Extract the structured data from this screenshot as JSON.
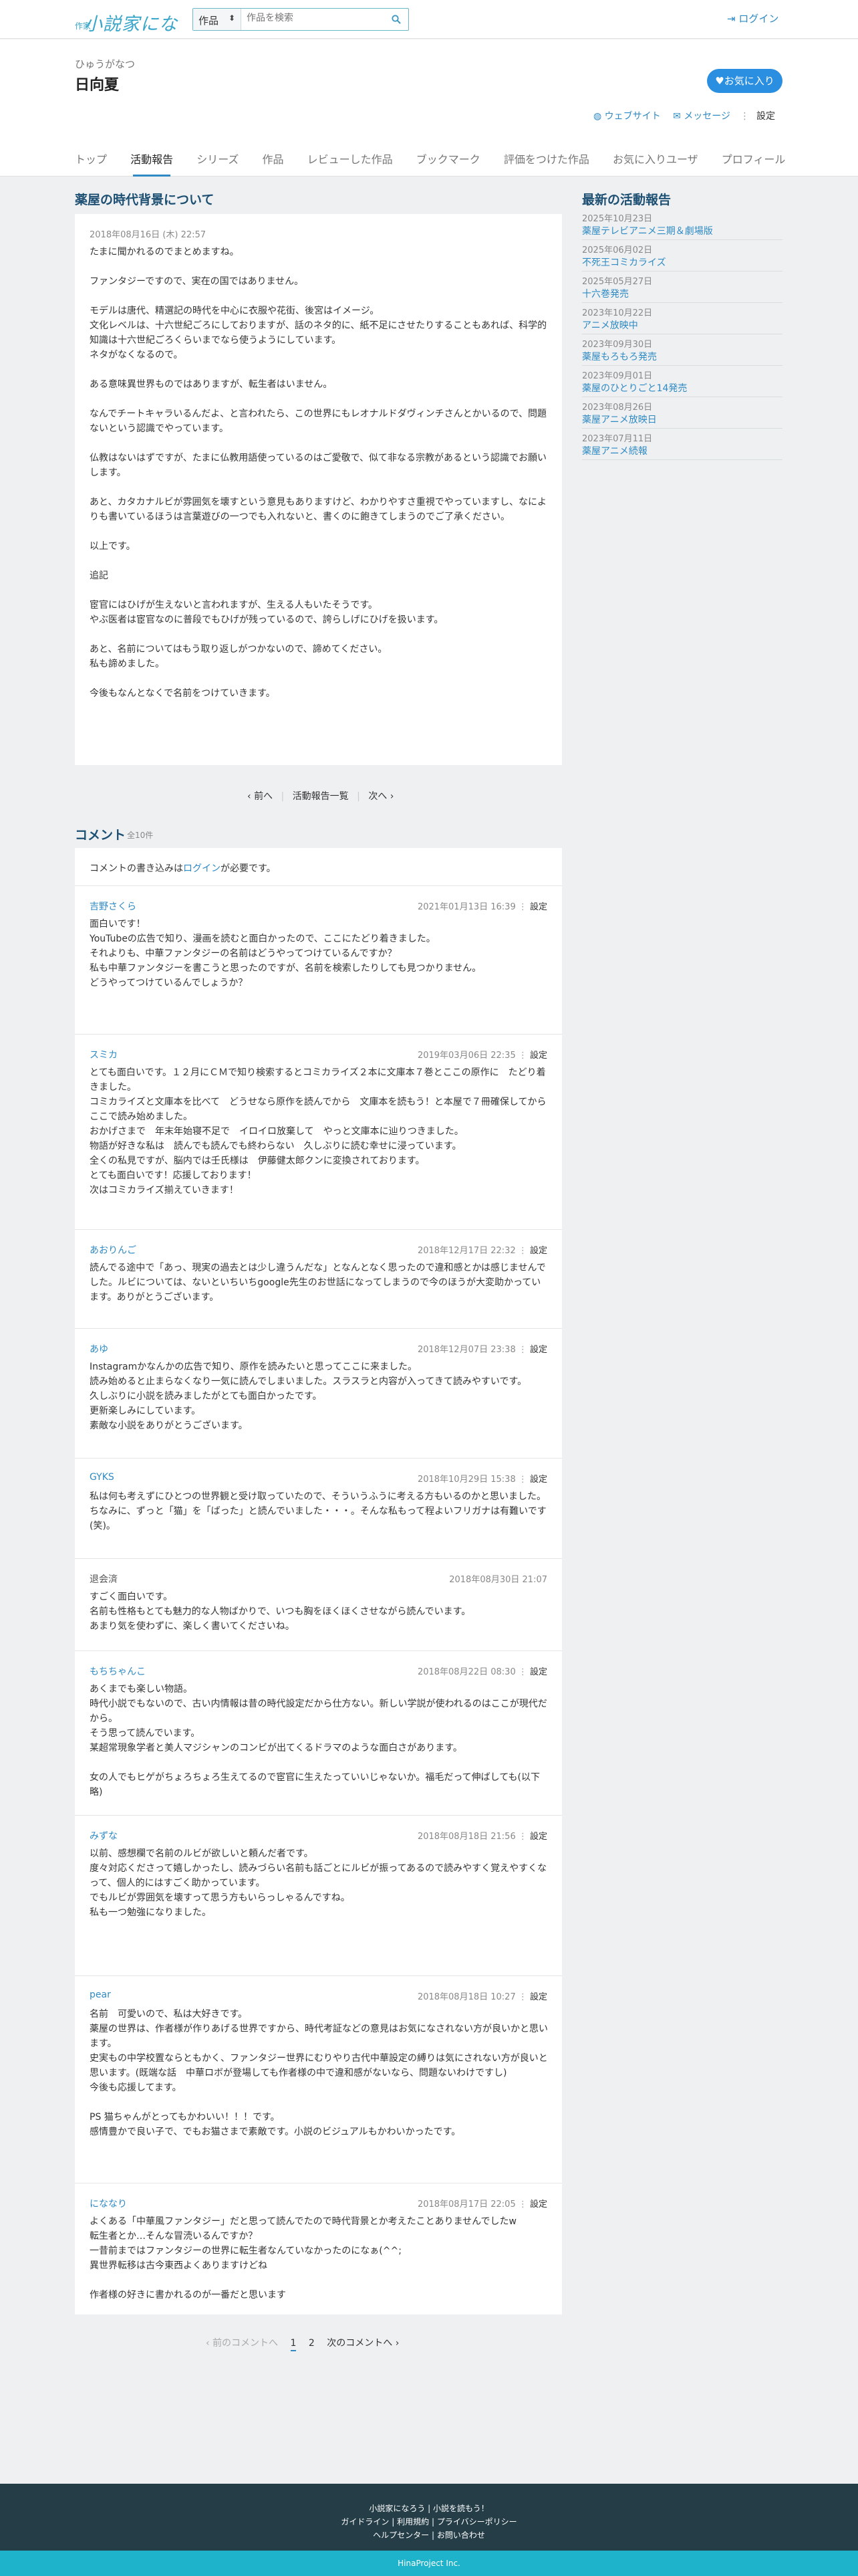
{
  "header": {
    "logo_small": "作家",
    "logo_main": "小説家になろう",
    "search_category": "作品",
    "search_placeholder": "作品を検索",
    "login": "ログイン"
  },
  "profile": {
    "kana": "ひゅうがなつ",
    "name": "日向夏",
    "favorite": "お気に入り",
    "website": "ウェブサイト",
    "message": "メッセージ",
    "settings": "設定",
    "tabs": [
      "トップ",
      "活動報告",
      "シリーズ",
      "作品",
      "レビューした作品",
      "ブックマーク",
      "評価をつけた作品",
      "お気に入りユーザ",
      "プロフィール"
    ]
  },
  "report": {
    "title": "薬屋の時代背景について",
    "date": "2018年08月16日 (木) 22:57",
    "body": "たまに聞かれるのでまとめますね。\n\nファンタジーですので、実在の国ではありません。\n\nモデルは唐代、精選記の時代を中心に衣服や花街、後宮はイメージ。\n文化レベルは、十六世紀ごろにしておりますが、話のネタ的に、紙不足にさせたりすることもあれば、科学的知識は十六世紀ごろくらいまでなら使うようにしています。\nネタがなくなるので。\n\nある意味異世界ものではありますが、転生者はいません。\n\nなんでチートキャラいるんだよ、と言われたら、この世界にもレオナルドダヴィンチさんとかいるので、問題ないという認識でやっています。\n\n仏教はないはずですが、たまに仏教用語使っているのはご愛敬で、似て非なる宗教があるという認識でお願いします。\n\nあと、カタカナルビが雰囲気を壊すという意見もありますけど、わかりやすさ重視でやっていますし、なによりも書いているほうは言葉遊びの一つでも入れないと、書くのに飽きてしまうのでご了承ください。\n\n以上です。\n\n追記\n\n宦官にはひげが生えないと言われますが、生える人もいたそうです。\nやぶ医者は宦官なのに普段でもひげが残っているので、誇らしげにひげを扱います。\n\nあと、名前についてはもう取り返しがつかないので、諦めてください。\n私も諦めました。\n\n今後もなんとなくで名前をつけていきます。",
    "pager_prev": "前へ",
    "pager_list": "活動報告一覧",
    "pager_next": "次へ"
  },
  "sidebar": {
    "title": "最新の活動報告",
    "items": [
      {
        "date": "2025年10月23日",
        "title": "薬屋テレビアニメ三期＆劇場版"
      },
      {
        "date": "2025年06月02日",
        "title": "不死王コミカライズ"
      },
      {
        "date": "2025年05月27日",
        "title": "十六巻発売"
      },
      {
        "date": "2023年10月22日",
        "title": "アニメ放映中"
      },
      {
        "date": "2023年09月30日",
        "title": "薬屋もろもろ発売"
      },
      {
        "date": "2023年09月01日",
        "title": "薬屋のひとりごと14発売"
      },
      {
        "date": "2023年08月26日",
        "title": "薬屋アニメ放映日"
      },
      {
        "date": "2023年07月11日",
        "title": "薬屋アニメ続報"
      }
    ]
  },
  "comments": {
    "title": "コメント",
    "count": "全10件",
    "login_note_before": "コメントの書き込みは",
    "login_link": "ログイン",
    "login_note_after": "が必要です。",
    "settings_label": "設定",
    "items": [
      {
        "name": "吉野さくら",
        "date": "2021年01月13日 16:39",
        "body": "面白いです！\nYouTubeの広告で知り、漫画を読むと面白かったので、ここにたどり着きました。\nそれよりも、中華ファンタジーの名前はどうやってつけているんですか？\n私も中華ファンタジーを書こうと思ったのですが、名前を検索したりしても見つかりません。\nどうやってつけているんでしょうか？"
      },
      {
        "name": "スミカ",
        "date": "2019年03月06日 22:35",
        "body": "とても面白いです。１２月にＣＭで知り検索するとコミカライズ２本に文庫本７巻とここの原作に　たどり着きました。\nコミカライズと文庫本を比べて　どうせなら原作を読んでから　文庫本を読もう！と本屋で７冊確保してから　ここで読み始めました。\nおかげさまで　年末年始寝不足で　イロイロ放棄して　やっと文庫本に辿りつきました。\n物語が好きな私は　読んでも読んでも終わらない　久しぶりに読む幸せに浸っています。\n全くの私見ですが、脳内では壬氏様は　伊藤健太郎クンに変換されております。\nとても面白いです！応援しております！\n次はコミカライズ揃えていきます！"
      },
      {
        "name": "あおりんご",
        "date": "2018年12月17日 22:32",
        "body": "読んでる途中で「あっ、現実の過去とは少し違うんだな」となんとなく思ったので違和感とかは感じませんでした。ルビについては、ないといちいちgoogle先生のお世話になってしまうので今のほうが大変助かっています。ありがとうございます。"
      },
      {
        "name": "あゆ",
        "date": "2018年12月07日 23:38",
        "body": "Instagramかなんかの広告で知り、原作を読みたいと思ってここに来ました。\n読み始めると止まらなくなり一気に読んでしまいました。スラスラと内容が入ってきて読みやすいです。\n久しぶりに小説を読みましたがとても面白かったです。\n更新楽しみにしています。\n素敵な小説をありがとうございます。"
      },
      {
        "name": "GYKS",
        "date": "2018年10月29日 15:38",
        "body": "私は何も考えずにひとつの世界観と受け取っていたので、そういうふうに考える方もいるのかと思いました。\nちなみに、ずっと「猫」を「ばった」と読んでいました・・・。そんな私もって程よいフリガナは有難いです(笑)。"
      },
      {
        "name": "退会済",
        "date": "2018年08月30日 21:07",
        "plain": true,
        "body": "すごく面白いです。\n名前も性格もとても魅力的な人物ばかりで、いつも胸をほくほくさせながら読んでいます。\nあまり気を使わずに、楽しく書いてくださいね。"
      },
      {
        "name": "もちちゃんこ",
        "date": "2018年08月22日 08:30",
        "body": "あくまでも楽しい物語。\n時代小説でもないので、古い内情報は昔の時代設定だから仕方ない。新しい学説が使われるのはここが現代だから。\nそう思って読んでいます。\n某超常現象学者と美人マジシャンのコンビが出てくるドラマのような面白さがあります。\n\n女の人でもヒゲがちょろちょろ生えてるので宦官に生えたっていいじゃないか。福毛だって伸ばしても(以下略)"
      },
      {
        "name": "みずな",
        "date": "2018年08月18日 21:56",
        "body": "以前、感想欄で名前のルビが欲しいと頼んだ者です。\n度々対応くださって嬉しかったし、読みづらい名前も話ごとにルビが振ってあるので読みやすく覚えやすくなって、個人的にはすごく助かっています。\nでもルビが雰囲気を壊すって思う方もいらっしゃるんですね。\n私も一つ勉強になりました。"
      },
      {
        "name": "pear",
        "date": "2018年08月18日 10:27",
        "body": "名前　可愛いので、私は大好きです。\n薬屋の世界は、作者様が作りあげる世界ですから、時代考証などの意見はお気になされない方が良いかと思います。\n史実もの中学校置ならともかく、ファンタジー世界にむりやり古代中華設定の縛りは気にされない方が良いと思います。(既端な話　中華ロボが登場しても作者様の中で違和感がないなら、問題ないわけですし)\n今後も応援してます。\n\nPS 猫ちゃんがとってもかわいい！！！です。\n感情豊かで良い子で、でもお猫さまで素敵です。小説のビジュアルもかわいかったです。"
      },
      {
        "name": "にななり",
        "date": "2018年08月17日 22:05",
        "body": "よくある「中華風ファンタジー」だと思って読んでたので時代背景とか考えたことありませんでしたw\n転生者とか…そんな冒涜いるんですか？\n一昔前まではファンタジーの世界に転生者なんていなかったのになぁ(^^;\n異世界転移は古今東西よくありますけどね\n\n作者様の好きに書かれるのが一番だと思います"
      }
    ],
    "pager_prev": "前のコメントへ",
    "pager_pages": [
      "1",
      "2"
    ],
    "pager_next": "次のコメントへ"
  },
  "footer": {
    "line1_a": "小説家になろう",
    "line1_b": "小説を読もう！",
    "line2_a": "ガイドライン",
    "line2_b": "利用規約",
    "line2_c": "プライバシーポリシー",
    "line3_a": "ヘルプセンター",
    "line3_b": "お問い合わせ",
    "company": "HinaProject Inc."
  }
}
